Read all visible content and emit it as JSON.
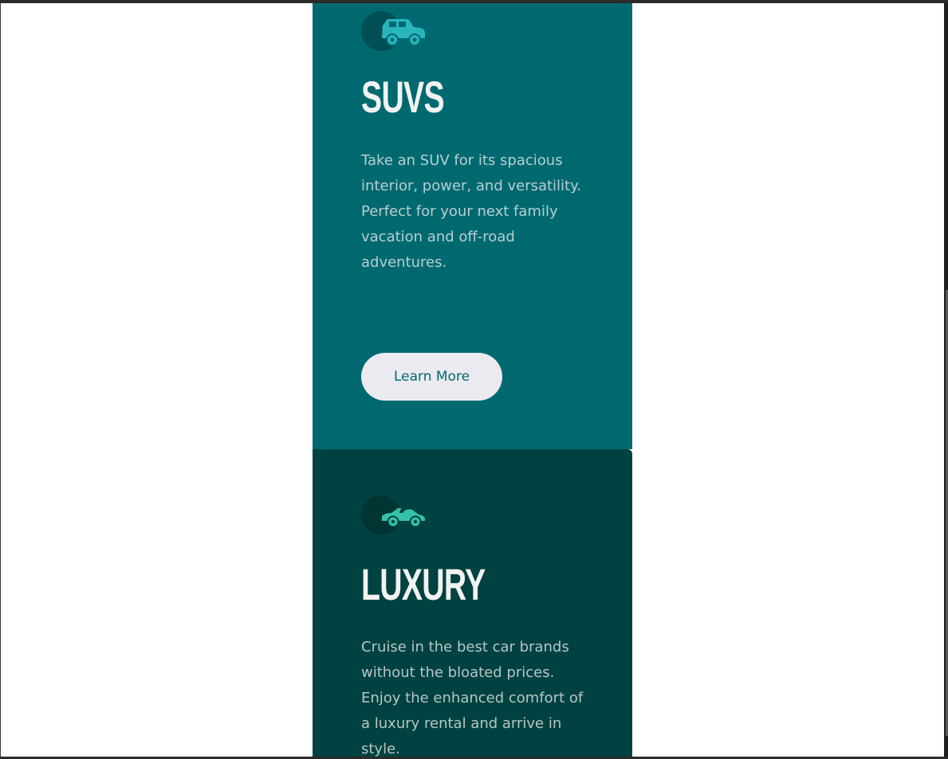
{
  "colors": {
    "suvs_bg": "#006970",
    "luxury_bg": "#004241",
    "button_bg": "#ebeaf0",
    "title": "#f2f2f2"
  },
  "cards": [
    {
      "icon": "suv-icon",
      "title": "SUVs",
      "text": "Take an SUV for its spacious interior, power, and versatility. Perfect for your next family vacation and off-road adventures.",
      "button_label": "Learn More"
    },
    {
      "icon": "luxury-car-icon",
      "title": "Luxury",
      "text": "Cruise in the best car brands without the bloated prices. Enjoy the enhanced comfort of a luxury rental and arrive in style."
    }
  ]
}
